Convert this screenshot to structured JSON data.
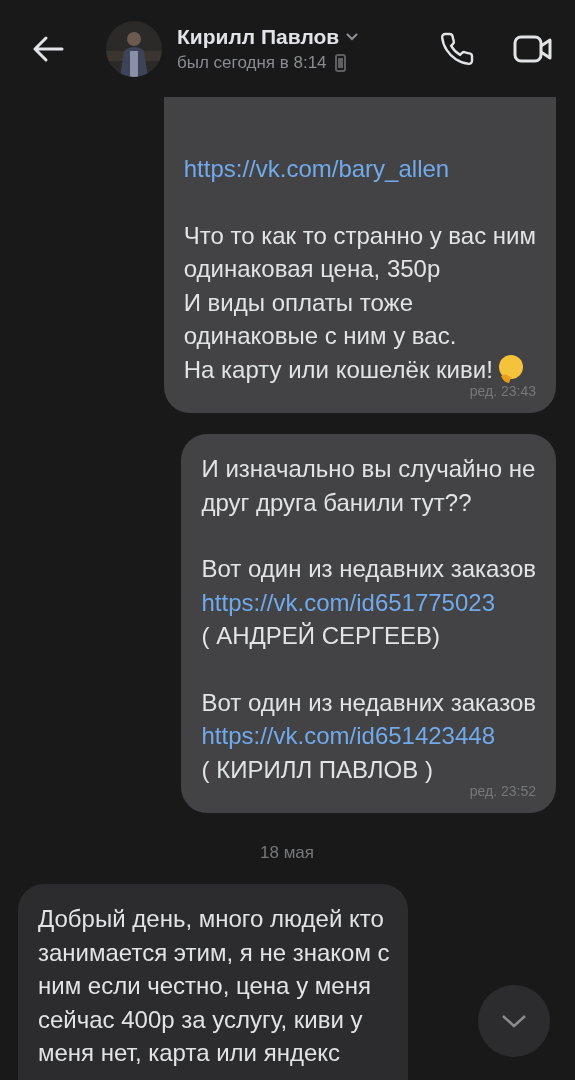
{
  "header": {
    "name": "Кирилл Павлов",
    "status": "был сегодня в 8:14"
  },
  "messages": [
    {
      "kind": "outgoing",
      "time": "ред. 23:43",
      "paragraphs": [
        [
          {
            "kind": "link",
            "text": "https://vk.com/bary_allen"
          }
        ],
        [
          {
            "kind": "text",
            "text": "Что то как то странно у вас ним"
          },
          {
            "kind": "text",
            "text": "одинаковая цена, 350р"
          },
          {
            "kind": "text",
            "text": "И виды оплаты  тоже"
          },
          {
            "kind": "text",
            "text": "одинаковые с ним у вас."
          },
          {
            "kind": "emoji",
            "text": "На карту или кошелёк киви!"
          }
        ]
      ]
    },
    {
      "kind": "outgoing",
      "time": "ред. 23:52",
      "paragraphs": [
        [
          {
            "kind": "text",
            "text": "И изначально вы случайно не"
          },
          {
            "kind": "text",
            "text": "друг друга банили тут??"
          }
        ],
        [
          {
            "kind": "text",
            "text": "Вот один из недавних заказов"
          },
          {
            "kind": "link",
            "text": "https://vk.com/id651775023"
          },
          {
            "kind": "text",
            "text": "( АНДРЕЙ СЕРГЕЕВ)"
          }
        ],
        [
          {
            "kind": "text",
            "text": "Вот один из недавних заказов"
          },
          {
            "kind": "link",
            "text": "https://vk.com/id651423448"
          },
          {
            "kind": "text",
            "text": "( КИРИЛЛ ПАВЛОВ )"
          }
        ]
      ]
    },
    {
      "kind": "date",
      "text": "18 мая"
    },
    {
      "kind": "incoming",
      "paragraphs": [
        [
          {
            "kind": "text",
            "text": "Добрый день, много людей кто"
          },
          {
            "kind": "text",
            "text": "занимается этим, я не знаком с"
          },
          {
            "kind": "text",
            "text": "ним если честно, цена у меня"
          },
          {
            "kind": "text",
            "text": "сейчас 400р за услугу, киви у"
          },
          {
            "kind": "text",
            "text": "меня нет, карта или яндекс"
          }
        ]
      ]
    }
  ]
}
